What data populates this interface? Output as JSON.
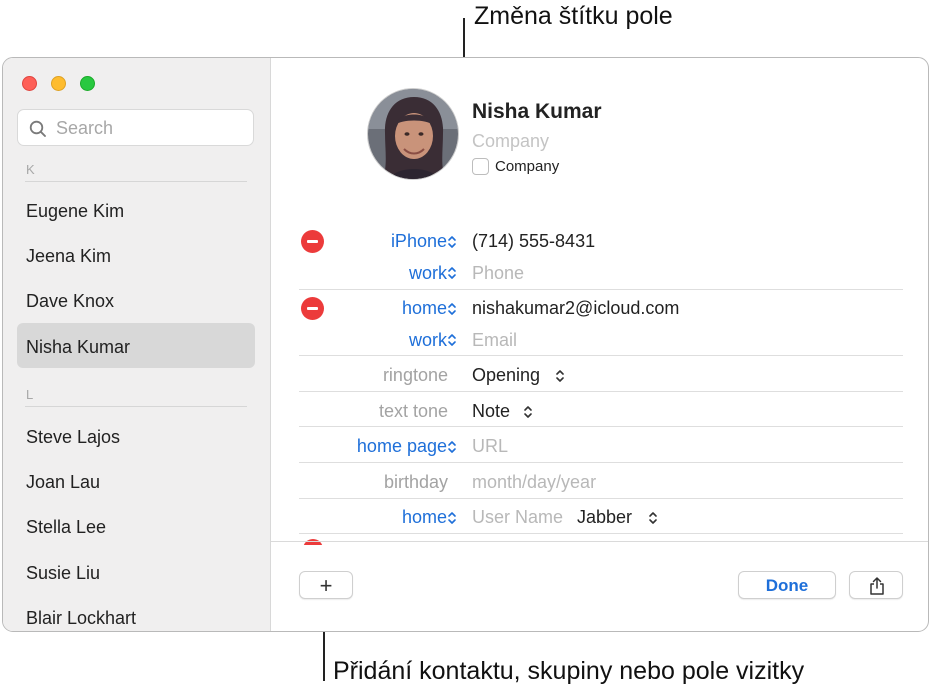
{
  "callouts": {
    "top": "Změna štítku pole",
    "bottom": "Přidání kontaktu, skupiny nebo pole vizitky"
  },
  "sidebar": {
    "search_placeholder": "Search",
    "sections": [
      {
        "letter": "K",
        "contacts": [
          "Eugene Kim",
          "Jeena Kim",
          "Dave Knox",
          "Nisha Kumar"
        ]
      },
      {
        "letter": "L",
        "contacts": [
          "Steve Lajos",
          "Joan Lau",
          "Stella Lee",
          "Susie Liu",
          "Blair Lockhart"
        ]
      }
    ],
    "selected": "Nisha Kumar"
  },
  "card": {
    "name": "Nisha  Kumar",
    "company_placeholder": "Company",
    "company_checkbox_label": "Company",
    "fields": {
      "phone1_label": "iPhone",
      "phone1_value": "(714) 555-8431",
      "phone2_label": "work",
      "phone2_placeholder": "Phone",
      "email1_label": "home",
      "email1_value": "nishakumar2@icloud.com",
      "email2_label": "work",
      "email2_placeholder": "Email",
      "ringtone_label": "ringtone",
      "ringtone_value": "Opening",
      "texttone_label": "text tone",
      "texttone_value": "Note",
      "homepage_label": "home page",
      "homepage_placeholder": "URL",
      "birthday_label": "birthday",
      "birthday_placeholder": "month/day/year",
      "im_label": "home",
      "im_placeholder": "User Name",
      "im_service": "Jabber"
    }
  },
  "footer": {
    "add_label": "+",
    "done_label": "Done"
  },
  "colors": {
    "accent": "#1e6fd9",
    "remove": "#ec3b3b",
    "selected_row": "#d8d8d8"
  },
  "icons": [
    "search-icon",
    "remove-icon",
    "chevron-updown-icon",
    "share-icon",
    "plus-icon"
  ]
}
